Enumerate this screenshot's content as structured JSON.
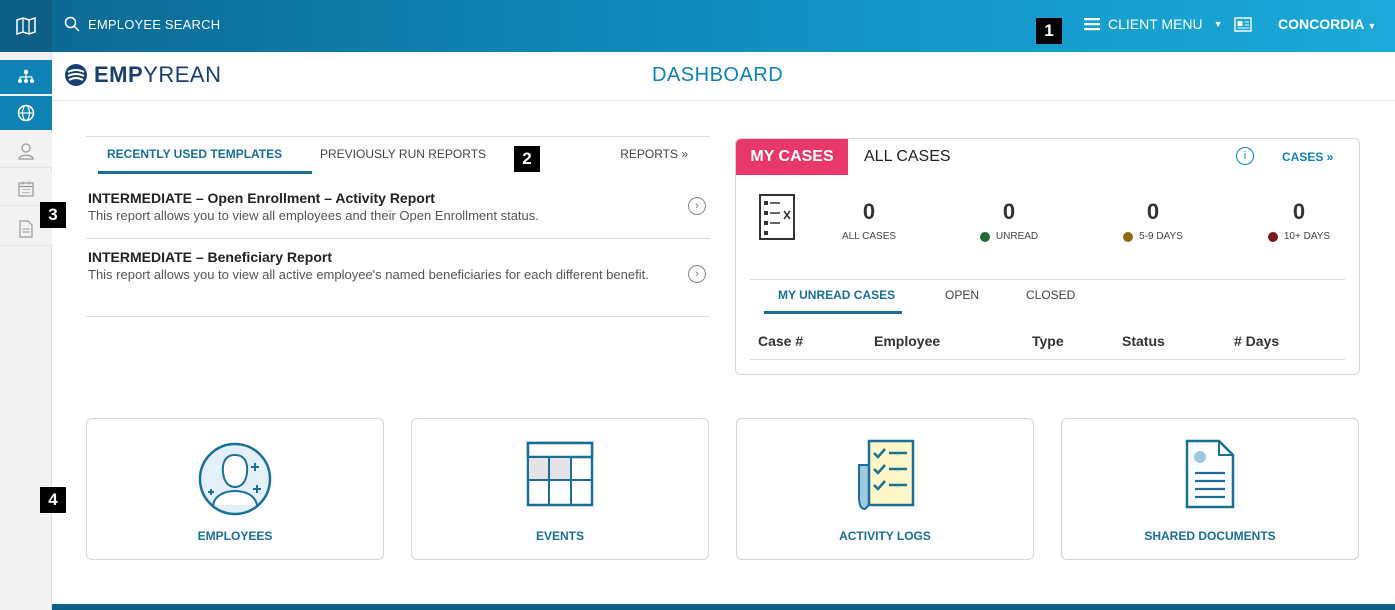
{
  "rail": {
    "top_icon": "map-icon",
    "items": [
      {
        "icon": "org-chart-icon"
      },
      {
        "icon": "globe-icon"
      },
      {
        "icon": "user-icon"
      },
      {
        "icon": "calendar-icon"
      },
      {
        "icon": "document-icon"
      }
    ]
  },
  "topbar": {
    "search_label": "EMPLOYEE SEARCH",
    "client_menu_label": "CLIENT MENU",
    "client_name": "CONCORDIA"
  },
  "header": {
    "logo_bold": "EMP",
    "logo_rest": "YREAN",
    "page_title": "DASHBOARD"
  },
  "reports": {
    "tabs": [
      "RECENTLY USED TEMPLATES",
      "PREVIOUSLY RUN REPORTS"
    ],
    "reports_link": "REPORTS »",
    "items": [
      {
        "title": "INTERMEDIATE – Open Enrollment – Activity Report",
        "description": "This report allows you to view all employees and their Open Enrollment status."
      },
      {
        "title": "INTERMEDIATE – Beneficiary Report",
        "description": "This report allows you to view all active employee's named beneficiaries for each different benefit."
      }
    ]
  },
  "cases": {
    "my_cases_label": "MY CASES",
    "all_cases_label": "ALL CASES",
    "cases_link": "CASES »",
    "stats": [
      {
        "value": "0",
        "label": "ALL CASES",
        "dot": ""
      },
      {
        "value": "0",
        "label": "UNREAD",
        "dot": "#1e6b2e"
      },
      {
        "value": "0",
        "label": "5-9 DAYS",
        "dot": "#8a6a12"
      },
      {
        "value": "0",
        "label": "10+ DAYS",
        "dot": "#7a1a22"
      }
    ],
    "subtabs": [
      "MY UNREAD CASES",
      "OPEN",
      "CLOSED"
    ],
    "columns": [
      "Case #",
      "Employee",
      "Type",
      "Status",
      "# Days"
    ]
  },
  "tiles": [
    {
      "label": "EMPLOYEES",
      "icon": "employees-icon"
    },
    {
      "label": "EVENTS",
      "icon": "events-grid-icon"
    },
    {
      "label": "ACTIVITY LOGS",
      "icon": "checklist-icon"
    },
    {
      "label": "SHARED DOCUMENTS",
      "icon": "shared-document-icon"
    }
  ],
  "markers": [
    "1",
    "2",
    "3",
    "4"
  ],
  "colors": {
    "brand_blue": "#1182b5",
    "brand_dark": "#0d5f86",
    "accent_pink": "#e8386a",
    "tab_active": "#1a6f96"
  }
}
